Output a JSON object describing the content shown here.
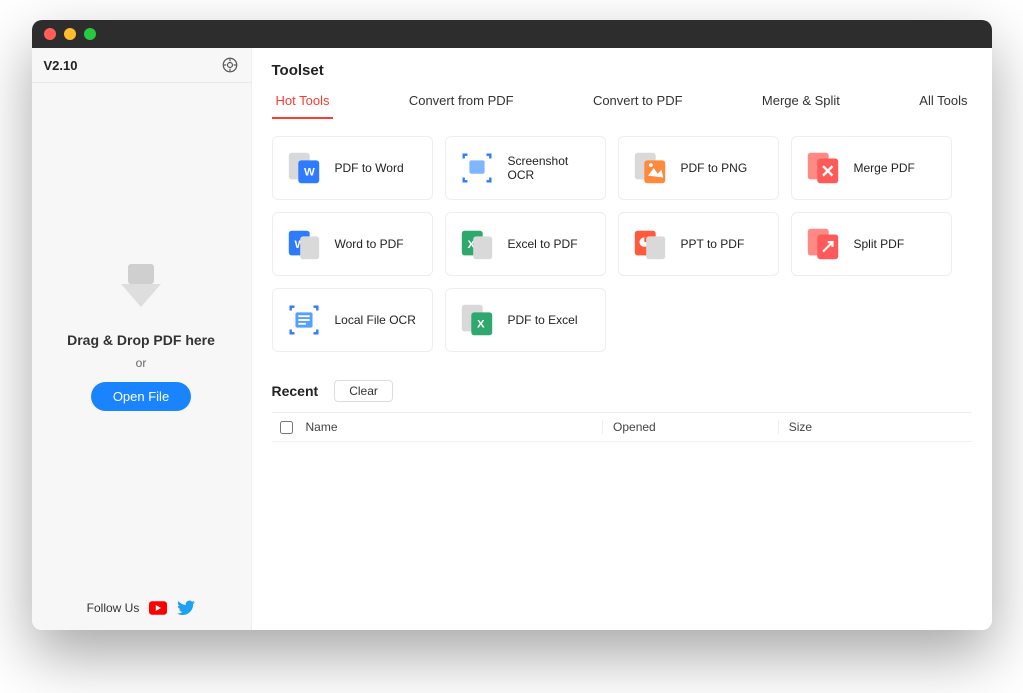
{
  "sidebar": {
    "version": "V2.10",
    "drop_text": "Drag & Drop PDF here",
    "or_text": "or",
    "open_file_label": "Open File",
    "follow_us_label": "Follow Us"
  },
  "main": {
    "title": "Toolset",
    "tabs": [
      {
        "label": "Hot Tools",
        "active": true
      },
      {
        "label": "Convert from PDF",
        "active": false
      },
      {
        "label": "Convert to PDF",
        "active": false
      },
      {
        "label": "Merge & Split",
        "active": false
      },
      {
        "label": "All Tools",
        "active": false
      }
    ],
    "tools": [
      {
        "label": "PDF to Word",
        "icon": "pdf-to-word"
      },
      {
        "label": "Screenshot OCR",
        "icon": "screenshot-ocr"
      },
      {
        "label": "PDF to PNG",
        "icon": "pdf-to-png"
      },
      {
        "label": "Merge PDF",
        "icon": "merge-pdf"
      },
      {
        "label": "Word to PDF",
        "icon": "word-to-pdf"
      },
      {
        "label": "Excel to PDF",
        "icon": "excel-to-pdf"
      },
      {
        "label": "PPT to PDF",
        "icon": "ppt-to-pdf"
      },
      {
        "label": "Split PDF",
        "icon": "split-pdf"
      },
      {
        "label": "Local File OCR",
        "icon": "local-file-ocr"
      },
      {
        "label": "PDF to Excel",
        "icon": "pdf-to-excel"
      }
    ],
    "recent": {
      "title": "Recent",
      "clear_label": "Clear",
      "columns": {
        "name": "Name",
        "opened": "Opened",
        "size": "Size"
      }
    }
  }
}
